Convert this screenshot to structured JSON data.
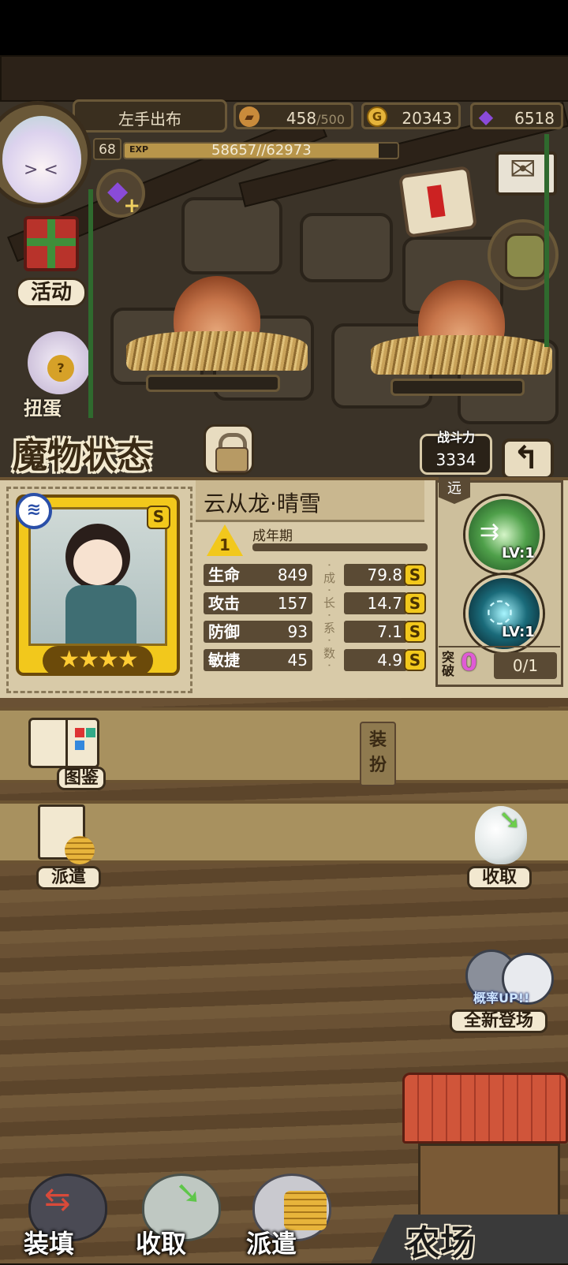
{
  "header": {
    "player_name": "左手出布",
    "level": "68",
    "exp_label": "EXP",
    "exp_text": "58657//62973",
    "exp_progress": 0.93
  },
  "resources": {
    "bread": {
      "current": "458",
      "max": "/500"
    },
    "gold": {
      "symbol": "G",
      "value": "20343"
    },
    "gem": {
      "value": "6518"
    }
  },
  "side_buttons": {
    "activity_label": "活动",
    "hidden_label": "扭蛋"
  },
  "monster_panel": {
    "title": "魔物状态",
    "power_label": "战斗力",
    "power_value": "3334",
    "name": "云从龙·晴雪",
    "rank_number": "1",
    "stage": "成年期",
    "grade": "S",
    "stars": "★★★★",
    "type_tag": "远",
    "stats": [
      {
        "label": "生命",
        "value": "849",
        "growth": "79.8",
        "grade": "S"
      },
      {
        "label": "攻击",
        "value": "157",
        "growth": "14.7",
        "grade": "S"
      },
      {
        "label": "防御",
        "value": "93",
        "growth": "7.1",
        "grade": "S"
      },
      {
        "label": "敏捷",
        "value": "45",
        "growth": "4.9",
        "grade": "S"
      }
    ],
    "growth_vertical_label": "·成·长·系·数·",
    "skills": [
      {
        "level": "LV:1"
      },
      {
        "level": "LV:1"
      }
    ],
    "breakthrough_label": "突破",
    "breakthrough_count": "0",
    "breakthrough_progress": "0/1"
  },
  "toolbar": {
    "catalog_label": "图鉴",
    "outfit_label": "装扮",
    "dispatch_label": "派遣",
    "collect_label": "收取",
    "new_arrival_label": "全新登场",
    "rate_up_label": "概率UP!!"
  },
  "bottom_bar": {
    "load_label": "装填",
    "collect_label": "收取",
    "dispatch_label": "派遣",
    "farm_label": "农场"
  },
  "colors": {
    "panel_bg": "#d8caa8",
    "grade_badge": "#f2c81c",
    "breakthrough_pink": "#e05ad6"
  }
}
